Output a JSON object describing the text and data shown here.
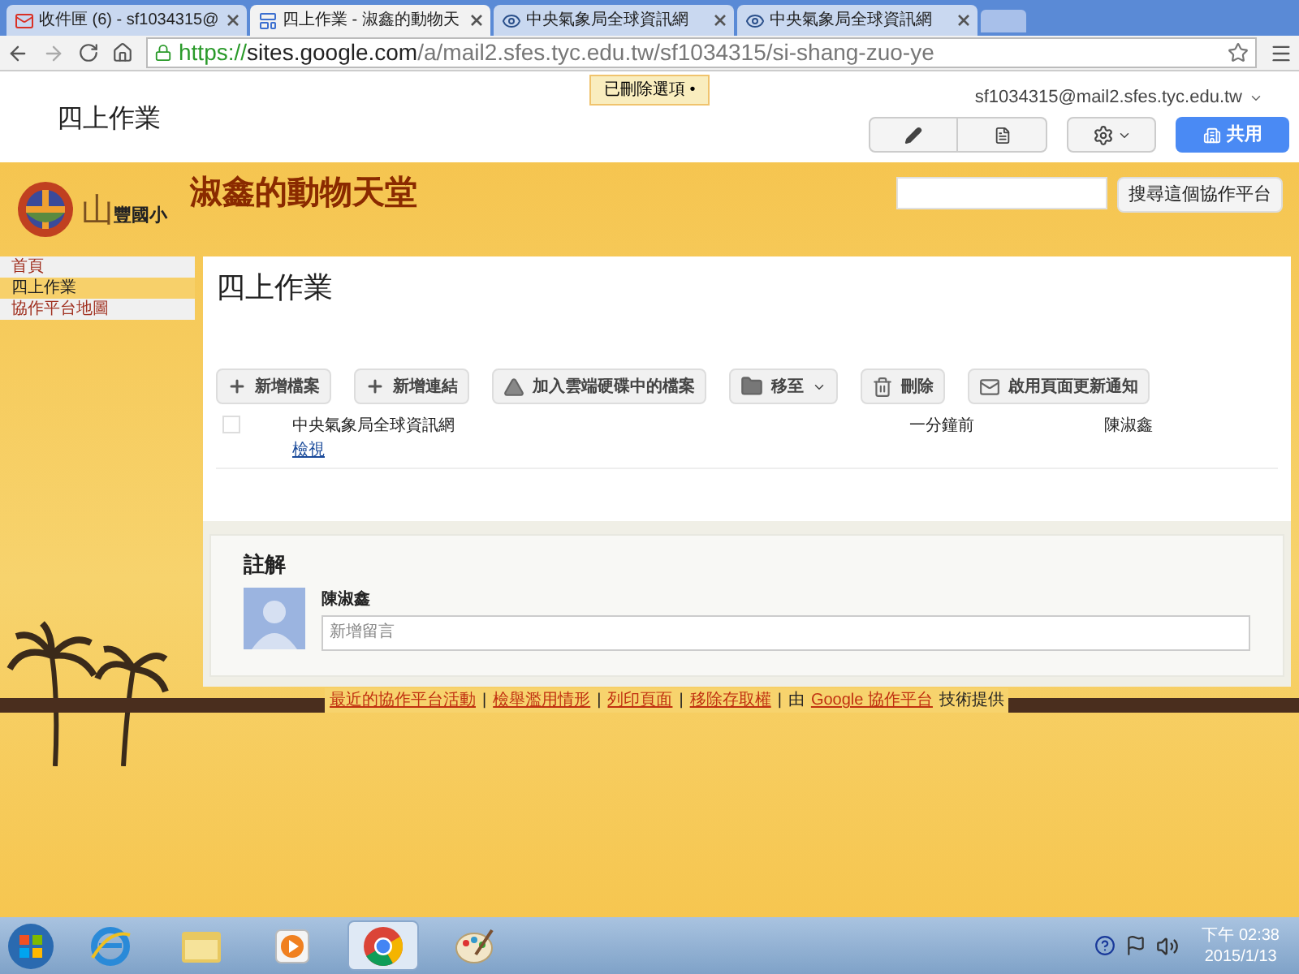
{
  "browser": {
    "tabs": [
      {
        "title": "收件匣 (6) - sf1034315@",
        "kind": "mail",
        "selected": false
      },
      {
        "title": "四上作業 - 淑鑫的動物天",
        "kind": "sites",
        "selected": true
      },
      {
        "title": "中央氣象局全球資訊網",
        "kind": "eye",
        "selected": false
      },
      {
        "title": "中央氣象局全球資訊網",
        "kind": "eye",
        "selected": false
      }
    ],
    "url": {
      "scheme": "https://",
      "host": "sites.google.com",
      "path": "/a/mail2.sfes.tyc.edu.tw/sf1034315/si-shang-zuo-ye"
    }
  },
  "notice": "已刪除選項 •",
  "topbar": {
    "account": "sf1034315@mail2.sfes.tyc.edu.tw",
    "page_title": "四上作業",
    "share": "共用"
  },
  "site": {
    "logo_mark": "山",
    "school": "豐國小",
    "title": "淑鑫的動物天堂",
    "search_button": "搜尋這個協作平台"
  },
  "sidebar": {
    "items": [
      {
        "label": "首頁",
        "selected": false
      },
      {
        "label": "四上作業",
        "selected": true
      },
      {
        "label": "協作平台地圖",
        "selected": false
      }
    ]
  },
  "content": {
    "title": "四上作業",
    "toolbar": [
      {
        "label": "新增檔案",
        "kind": "plus"
      },
      {
        "label": "新增連結",
        "kind": "plus"
      },
      {
        "label": "加入雲端硬碟中的檔案",
        "kind": "drive"
      },
      {
        "label": "移至",
        "kind": "folder"
      },
      {
        "label": "刪除",
        "kind": "trash"
      },
      {
        "label": "啟用頁面更新通知",
        "kind": "mail"
      }
    ],
    "files": [
      {
        "checked": false,
        "name": "中央氣象局全球資訊網",
        "action": "檢視",
        "time": "一分鐘前",
        "author": "陳淑鑫"
      }
    ]
  },
  "comments": {
    "title": "註解",
    "author": "陳淑鑫",
    "placeholder": "新增留言"
  },
  "footer": [
    {
      "text": "最近的協作平台活動",
      "kind": "link"
    },
    {
      "text": "|",
      "kind": "sep"
    },
    {
      "text": "檢舉濫用情形",
      "kind": "link"
    },
    {
      "text": "|",
      "kind": "sep"
    },
    {
      "text": "列印頁面",
      "kind": "link"
    },
    {
      "text": "|",
      "kind": "sep"
    },
    {
      "text": "移除存取權",
      "kind": "link"
    },
    {
      "text": "|",
      "kind": "sep"
    },
    {
      "text": "由",
      "kind": "text"
    },
    {
      "text": "Google 協作平台",
      "kind": "link"
    },
    {
      "text": "技術提供",
      "kind": "text"
    }
  ],
  "taskbar": {
    "apps": [
      {
        "kind": "ie",
        "selected": false
      },
      {
        "kind": "folder",
        "selected": false
      },
      {
        "kind": "media",
        "selected": false
      },
      {
        "kind": "chrome",
        "selected": true
      },
      {
        "kind": "paint",
        "selected": false
      }
    ],
    "time": "下午 02:38",
    "date": "2015/1/13"
  }
}
